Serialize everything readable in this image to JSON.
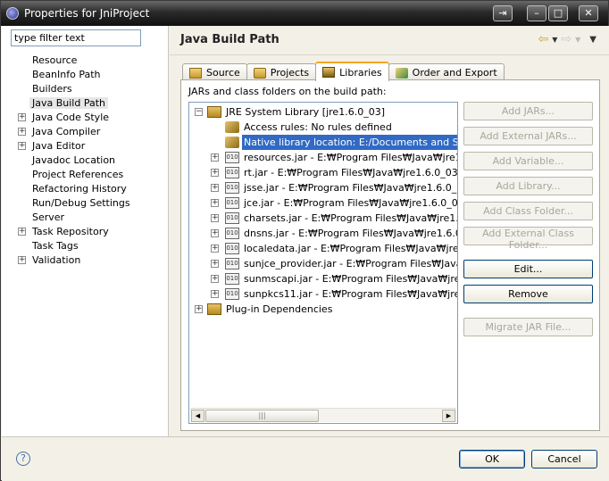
{
  "window": {
    "title": "Properties for JniProject"
  },
  "filter": {
    "placeholder": "type filter text",
    "value": "type filter text"
  },
  "nav": {
    "items": [
      {
        "label": "Resource",
        "expandable": false
      },
      {
        "label": "BeanInfo Path",
        "expandable": false
      },
      {
        "label": "Builders",
        "expandable": false
      },
      {
        "label": "Java Build Path",
        "expandable": false,
        "selected": true
      },
      {
        "label": "Java Code Style",
        "expandable": true
      },
      {
        "label": "Java Compiler",
        "expandable": true
      },
      {
        "label": "Java Editor",
        "expandable": true
      },
      {
        "label": "Javadoc Location",
        "expandable": false
      },
      {
        "label": "Project References",
        "expandable": false
      },
      {
        "label": "Refactoring History",
        "expandable": false
      },
      {
        "label": "Run/Debug Settings",
        "expandable": false
      },
      {
        "label": "Server",
        "expandable": false
      },
      {
        "label": "Task Repository",
        "expandable": true
      },
      {
        "label": "Task Tags",
        "expandable": false
      },
      {
        "label": "Validation",
        "expandable": true
      }
    ]
  },
  "page": {
    "title": "Java Build Path"
  },
  "tabs": [
    {
      "label": "Source",
      "icon": "source-folder-icon"
    },
    {
      "label": "Projects",
      "icon": "projects-icon"
    },
    {
      "label": "Libraries",
      "icon": "libraries-icon",
      "active": true
    },
    {
      "label": "Order and Export",
      "icon": "order-export-icon"
    }
  ],
  "libraries": {
    "panel_label": "JARs and class folders on the build path:",
    "tree": [
      {
        "label": "JRE System Library [jre1.6.0_03]",
        "level": 0,
        "exp": "−",
        "icon": "library"
      },
      {
        "label": "Access rules: No rules defined",
        "level": 1,
        "exp": "",
        "icon": "key"
      },
      {
        "label": "Native library location: E:/Documents and Setting",
        "level": 1,
        "exp": "",
        "icon": "key",
        "selected": true
      },
      {
        "label": "resources.jar - E:₩Program Files₩Java₩jre1.6.",
        "level": 1,
        "exp": "+",
        "icon": "jar"
      },
      {
        "label": "rt.jar - E:₩Program Files₩Java₩jre1.6.0_03₩li",
        "level": 1,
        "exp": "+",
        "icon": "jar"
      },
      {
        "label": "jsse.jar - E:₩Program Files₩Java₩jre1.6.0_03₩",
        "level": 1,
        "exp": "+",
        "icon": "jar"
      },
      {
        "label": "jce.jar - E:₩Program Files₩Java₩jre1.6.0_03₩",
        "level": 1,
        "exp": "+",
        "icon": "jar"
      },
      {
        "label": "charsets.jar - E:₩Program Files₩Java₩jre1.6.0",
        "level": 1,
        "exp": "+",
        "icon": "jar"
      },
      {
        "label": "dnsns.jar - E:₩Program Files₩Java₩jre1.6.0_0",
        "level": 1,
        "exp": "+",
        "icon": "jar"
      },
      {
        "label": "localedata.jar - E:₩Program Files₩Java₩jre1.6",
        "level": 1,
        "exp": "+",
        "icon": "jar"
      },
      {
        "label": "sunjce_provider.jar - E:₩Program Files₩Java₩j",
        "level": 1,
        "exp": "+",
        "icon": "jar"
      },
      {
        "label": "sunmscapi.jar - E:₩Program Files₩Java₩jre1.6",
        "level": 1,
        "exp": "+",
        "icon": "jar"
      },
      {
        "label": "sunpkcs11.jar - E:₩Program Files₩Java₩jre1.6",
        "level": 1,
        "exp": "+",
        "icon": "jar"
      },
      {
        "label": "Plug-in Dependencies",
        "level": 0,
        "exp": "+",
        "icon": "library"
      }
    ],
    "buttons": [
      {
        "label": "Add JARs...",
        "enabled": false
      },
      {
        "label": "Add External JARs...",
        "enabled": false
      },
      {
        "label": "Add Variable...",
        "enabled": false
      },
      {
        "label": "Add Library...",
        "enabled": false
      },
      {
        "label": "Add Class Folder...",
        "enabled": false
      },
      {
        "label": "Add External Class Folder...",
        "enabled": false
      },
      {
        "label": "Edit...",
        "enabled": true
      },
      {
        "label": "Remove",
        "enabled": true
      },
      {
        "label": "Migrate JAR File...",
        "enabled": false
      }
    ]
  },
  "dialog": {
    "ok_label": "OK",
    "cancel_label": "Cancel",
    "help_glyph": "?"
  },
  "colors": {
    "selection": "#316ac5",
    "active_tab_accent": "#f5a623"
  }
}
